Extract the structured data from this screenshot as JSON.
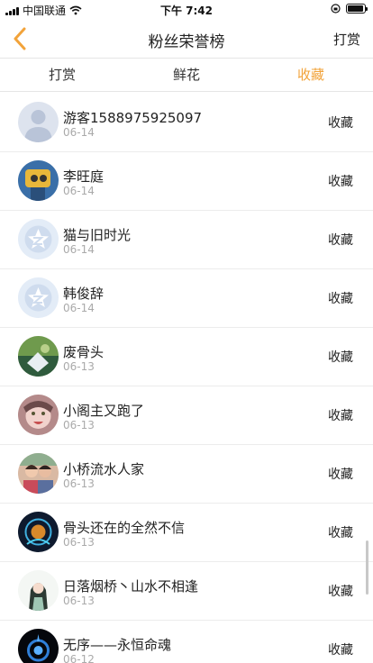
{
  "status": {
    "carrier": "中国联通",
    "time": "下午 7:42",
    "battery_level": 0.95
  },
  "nav": {
    "title": "粉丝荣誉榜",
    "right_label": "打赏",
    "accent": "#f2a33a"
  },
  "tabs": [
    {
      "label": "打赏",
      "active": false
    },
    {
      "label": "鲜花",
      "active": false
    },
    {
      "label": "收藏",
      "active": true
    }
  ],
  "rows": [
    {
      "name": "游客1588975925097",
      "date": "06-14",
      "action": "收藏",
      "avatar": "default-person"
    },
    {
      "name": "李旺庭",
      "date": "06-14",
      "action": "收藏",
      "avatar": "photo-yellow"
    },
    {
      "name": "猫与旧时光",
      "date": "06-14",
      "action": "收藏",
      "avatar": "default-star"
    },
    {
      "name": "韩俊辞",
      "date": "06-14",
      "action": "收藏",
      "avatar": "default-star"
    },
    {
      "name": "废骨头",
      "date": "06-13",
      "action": "收藏",
      "avatar": "photo-green"
    },
    {
      "name": "小阁主又跑了",
      "date": "06-13",
      "action": "收藏",
      "avatar": "photo-pink"
    },
    {
      "name": "小桥流水人家",
      "date": "06-13",
      "action": "收藏",
      "avatar": "photo-couple"
    },
    {
      "name": "骨头还在的全然不信",
      "date": "06-13",
      "action": "收藏",
      "avatar": "photo-dark"
    },
    {
      "name": "日落烟桥丶山水不相逢",
      "date": "06-13",
      "action": "收藏",
      "avatar": "photo-girl"
    },
    {
      "name": "无序——永恒命魂",
      "date": "06-12",
      "action": "收藏",
      "avatar": "photo-blue"
    }
  ]
}
